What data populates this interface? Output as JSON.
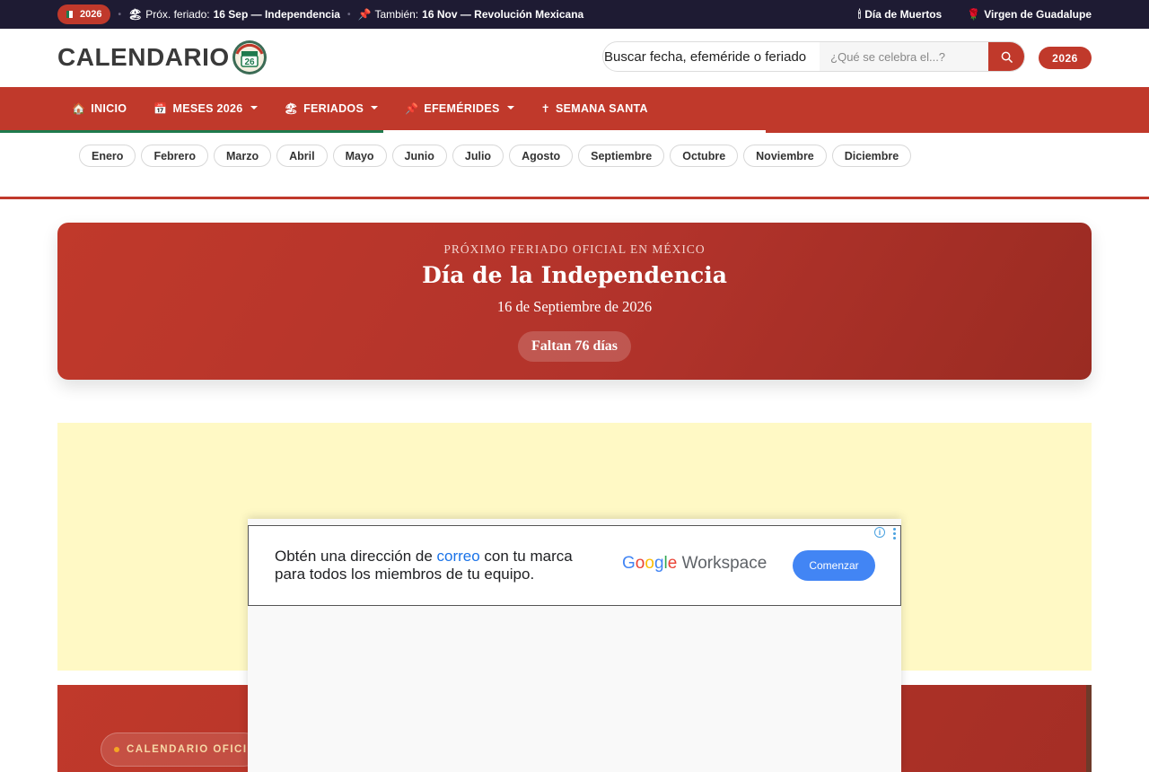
{
  "topbar": {
    "year": "2026",
    "next_holiday_label": "Próx. feriado:",
    "next_holiday_value": "16 Sep — Independencia",
    "also_label": "También:",
    "also_value": "16 Nov — Revolución Mexicana",
    "links": [
      "Día de Muertos",
      "Virgen de Guadalupe"
    ],
    "icons": [
      "mexico-flag",
      "beach-umbrella",
      "pushpin",
      "candle",
      "rose"
    ]
  },
  "header": {
    "logo_text": "CALENDARIO",
    "logo_seal_text": "26",
    "search_label": "Buscar fecha, efeméride o feriado",
    "search_placeholder": "¿Qué se celebra el...?",
    "year_button": "2026"
  },
  "nav": {
    "items": [
      {
        "label": "INICIO",
        "icon": "🏠",
        "has_caret": false
      },
      {
        "label": "MESES 2026",
        "icon": "📅",
        "has_caret": true
      },
      {
        "label": "FERIADOS",
        "icon": "🏖",
        "has_caret": true
      },
      {
        "label": "EFEMÉRIDES",
        "icon": "📌",
        "has_caret": true
      },
      {
        "label": "SEMANA SANTA",
        "icon": "✝",
        "has_caret": false
      }
    ]
  },
  "months": [
    "Enero",
    "Febrero",
    "Marzo",
    "Abril",
    "Mayo",
    "Junio",
    "Julio",
    "Agosto",
    "Septiembre",
    "Octubre",
    "Noviembre",
    "Diciembre"
  ],
  "hero": {
    "kicker": "PRÓXIMO FERIADO OFICIAL EN MÉXICO",
    "title": "Día de la Independencia",
    "date": "16 de Septiembre de 2026",
    "countdown": "Faltan 76 días"
  },
  "ad": {
    "line1_pre": "Obtén una dirección de ",
    "line1_highlight": "correo",
    "line1_post": " con tu marca",
    "line2": "para todos los miembros de tu equipo.",
    "brand": "Google",
    "product": "Workspace",
    "cta": "Comenzar"
  },
  "banner": {
    "pill": "CALENDARIO OFICI"
  },
  "colors": {
    "primary_red": "#c0392b",
    "topbar_bg": "#1e1b33",
    "ad_bg": "#fff9c5",
    "flag_green": "#1f7a4d",
    "link_blue": "#1a73e8"
  }
}
